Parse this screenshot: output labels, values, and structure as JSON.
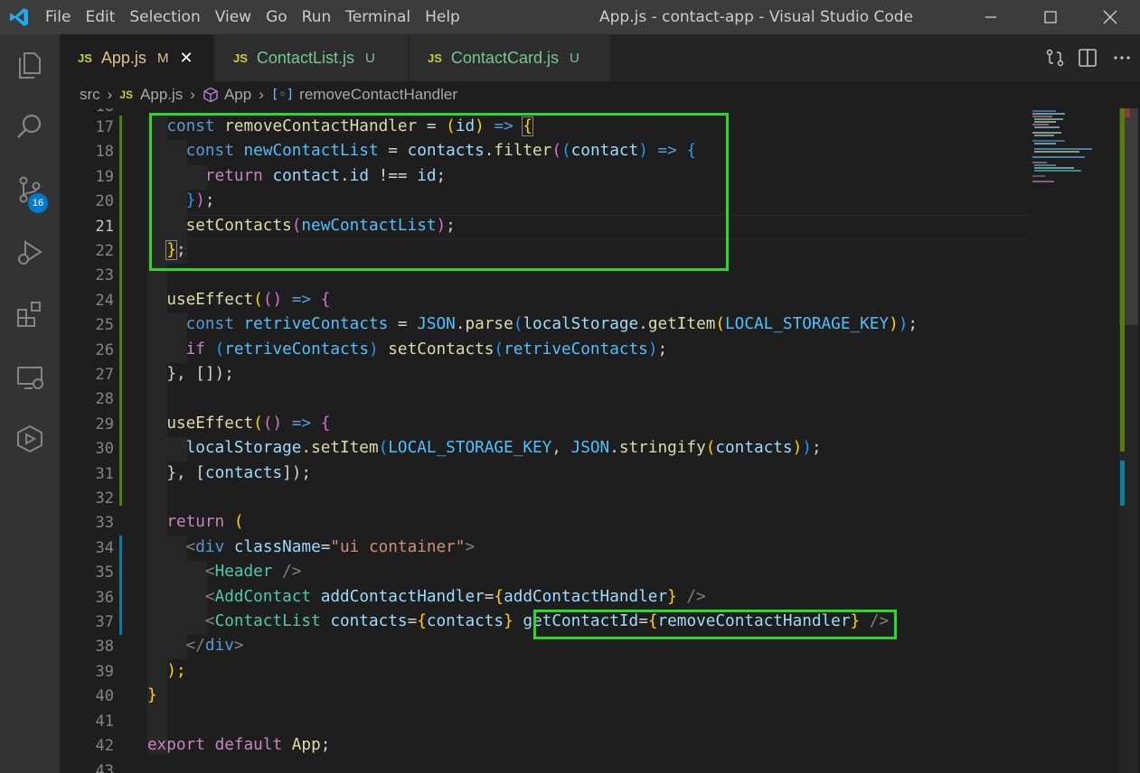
{
  "window": {
    "title": "App.js - contact-app - Visual Studio Code",
    "menu": [
      "File",
      "Edit",
      "Selection",
      "View",
      "Go",
      "Run",
      "Terminal",
      "Help"
    ]
  },
  "activity_bar": {
    "source_control_badge": "16"
  },
  "tabs": [
    {
      "lang": "JS",
      "name": "App.js",
      "status": "M",
      "active": true
    },
    {
      "lang": "JS",
      "name": "ContactList.js",
      "status": "U",
      "active": false
    },
    {
      "lang": "JS",
      "name": "ContactCard.js",
      "status": "U",
      "active": false
    }
  ],
  "breadcrumb": {
    "folder": "src",
    "file_lang": "JS",
    "file": "App.js",
    "component": "App",
    "symbol": "removeContactHandler"
  },
  "editor": {
    "current_line": 21,
    "line_numbers": [
      "17",
      "18",
      "19",
      "20",
      "21",
      "22",
      "23",
      "24",
      "25",
      "26",
      "27",
      "28",
      "29",
      "30",
      "31",
      "32",
      "33",
      "34",
      "35",
      "36",
      "37",
      "38",
      "39",
      "40",
      "41",
      "42",
      "43"
    ]
  },
  "code": {
    "l17": {
      "kw": "const",
      "name": "removeContactHandler",
      "eq": " = ",
      "param": "id",
      "arrow": "=>"
    },
    "l18": {
      "kw": "const",
      "name": "newContactList",
      "src": "contacts",
      "method": "filter",
      "param": "contact",
      "arrow": "=>"
    },
    "l19": {
      "kw": "return",
      "obj": "contact",
      "prop": "id",
      "op": " !== ",
      "rhs": "id"
    },
    "l20": {
      "text": "});"
    },
    "l21": {
      "fn": "setContacts",
      "arg": "newContactList"
    },
    "l22": {
      "text": "};"
    },
    "l24": {
      "fn": "useEffect",
      "arrow": "=>"
    },
    "l25": {
      "kw": "const",
      "name": "retriveContacts",
      "json": "JSON",
      "parse": "parse",
      "ls": "localStorage",
      "getItem": "getItem",
      "key": "LOCAL_STORAGE_KEY"
    },
    "l26": {
      "kw": "if",
      "cond": "retriveContacts",
      "fn": "setContacts",
      "arg": "retriveContacts"
    },
    "l27": {
      "text": "}, []);"
    },
    "l29": {
      "fn": "useEffect",
      "arrow": "=>"
    },
    "l30": {
      "ls": "localStorage",
      "setItem": "setItem",
      "key": "LOCAL_STORAGE_KEY",
      "json": "JSON",
      "stringify": "stringify",
      "arg": "contacts"
    },
    "l31": {
      "pre": "}, [",
      "arg": "contacts",
      "post": "]);"
    },
    "l33": {
      "kw": "return",
      "paren": " ("
    },
    "l34": {
      "tag": "div",
      "attr": "className",
      "value": "\"ui container\""
    },
    "l35": {
      "tag": "Header"
    },
    "l36": {
      "tag": "AddContact",
      "attr": "addContactHandler",
      "value": "addContactHandler"
    },
    "l37": {
      "tag": "ContactList",
      "attr1": "contacts",
      "value1": "contacts",
      "attr2": "getContactId",
      "value2": "removeContactHandler"
    },
    "l38": {
      "tag": "div"
    },
    "l39": {
      "text": ");"
    },
    "l40": {
      "text": "}"
    },
    "l42": {
      "kw1": "export",
      "kw2": "default",
      "name": "App"
    }
  },
  "highlights": [
    "removeContactHandler function block",
    "getContactId prop"
  ],
  "colors": {
    "highlight_border": "#2bd72b",
    "git_added": "#587c0c",
    "git_modified": "#0c7d9d",
    "accent": "#007acc"
  }
}
